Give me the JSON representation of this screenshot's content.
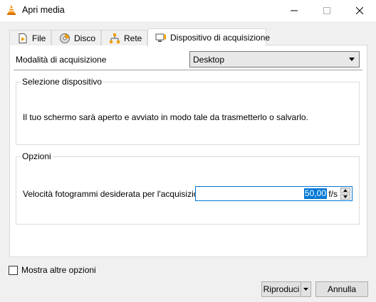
{
  "window": {
    "title": "Apri media",
    "icon": "vlc-cone-icon"
  },
  "tabs": [
    {
      "label": "File",
      "icon": "file-icon"
    },
    {
      "label": "Disco",
      "icon": "disc-icon"
    },
    {
      "label": "Rete",
      "icon": "network-icon"
    },
    {
      "label": "Dispositivo di acquisizione",
      "icon": "capture-device-icon",
      "active": true
    }
  ],
  "capture": {
    "mode_label": "Modalità di acquisizione",
    "mode_value": "Desktop"
  },
  "device_group": {
    "title": "Selezione dispositivo",
    "text": "Il tuo schermo sarà aperto e avviato in modo tale da trasmetterlo o salvarlo."
  },
  "options_group": {
    "title": "Opzioni",
    "fps_label": "Velocità fotogrammi desiderata per l'acquisizione.",
    "fps_value": "50,00",
    "fps_unit": "f/s"
  },
  "footer": {
    "more_options_label": "Mostra altre opzioni",
    "more_options_checked": false,
    "play_label": "Riproduci",
    "cancel_label": "Annulla"
  },
  "colors": {
    "accent": "#0078d7",
    "vlc_orange": "#f48b00"
  }
}
